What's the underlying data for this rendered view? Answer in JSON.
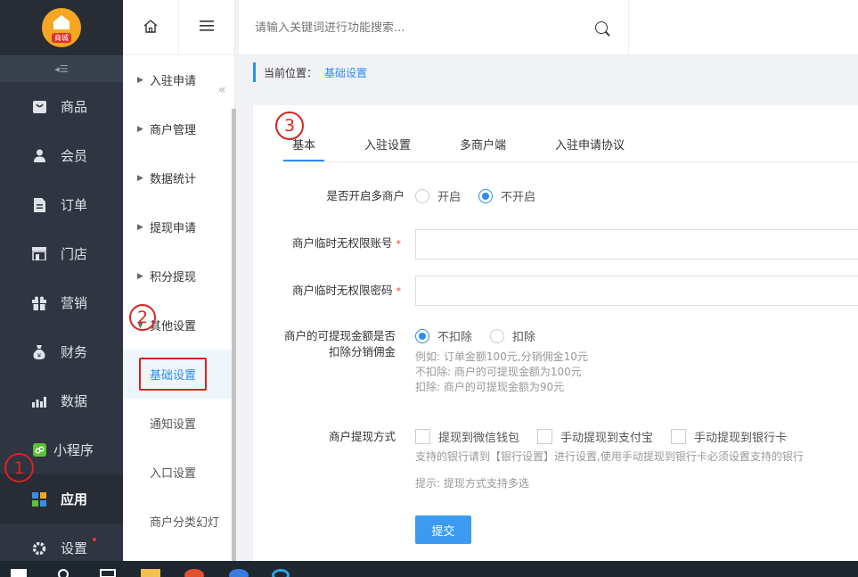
{
  "logo": {
    "text": "商城"
  },
  "leftnav": {
    "items": [
      {
        "label": "商品",
        "icon": "bag-icon"
      },
      {
        "label": "会员",
        "icon": "user-icon"
      },
      {
        "label": "订单",
        "icon": "document-icon"
      },
      {
        "label": "门店",
        "icon": "store-icon"
      },
      {
        "label": "营销",
        "icon": "gift-icon"
      },
      {
        "label": "财务",
        "icon": "money-bag-icon"
      },
      {
        "label": "数据",
        "icon": "bar-chart-icon"
      },
      {
        "label": "小程序",
        "icon": "mini-program-icon"
      },
      {
        "label": "应用",
        "icon": "apps-grid-icon"
      },
      {
        "label": "设置",
        "icon": "gear-icon"
      }
    ]
  },
  "subnav": {
    "items": [
      {
        "label": "入驻申请"
      },
      {
        "label": "商户管理"
      },
      {
        "label": "数据统计"
      },
      {
        "label": "提现申请"
      },
      {
        "label": "积分提现"
      },
      {
        "label": "其他设置"
      }
    ],
    "children": [
      {
        "label": "基础设置"
      },
      {
        "label": "通知设置"
      },
      {
        "label": "入口设置"
      },
      {
        "label": "商户分类幻灯"
      }
    ]
  },
  "search": {
    "placeholder": "请输入关键词进行功能搜索..."
  },
  "breadcrumb": {
    "prefix": "当前位置：",
    "current": "基础设置"
  },
  "tabs": [
    "基本",
    "入驻设置",
    "多商户端",
    "入驻申请协议"
  ],
  "form": {
    "multi_merchant": {
      "label": "是否开启多商户",
      "options": [
        "开启",
        "不开启"
      ],
      "selected": "不开启"
    },
    "temp_account": {
      "label": "商户临时无权限账号",
      "value": ""
    },
    "temp_password": {
      "label": "商户临时无权限密码",
      "value": ""
    },
    "deduct": {
      "label_line1": "商户的可提现金额是否",
      "label_line2": "扣除分销佣金",
      "options": [
        "不扣除",
        "扣除"
      ],
      "selected": "不扣除",
      "hints": [
        "例如: 订单金额100元,分销佣金10元",
        "不扣除: 商户的可提现金额为100元",
        "扣除: 商户的可提现金额为90元"
      ]
    },
    "withdraw": {
      "label": "商户提现方式",
      "options": [
        "提现到微信钱包",
        "手动提现到支付宝",
        "手动提现到银行卡"
      ],
      "hint1": "支持的银行请到【银行设置】进行设置,使用手动提现到银行卡必须设置支持的银行",
      "hint2": "提示: 提现方式支持多选"
    },
    "submit_label": "提交"
  },
  "annotations": [
    "1",
    "2",
    "3"
  ]
}
